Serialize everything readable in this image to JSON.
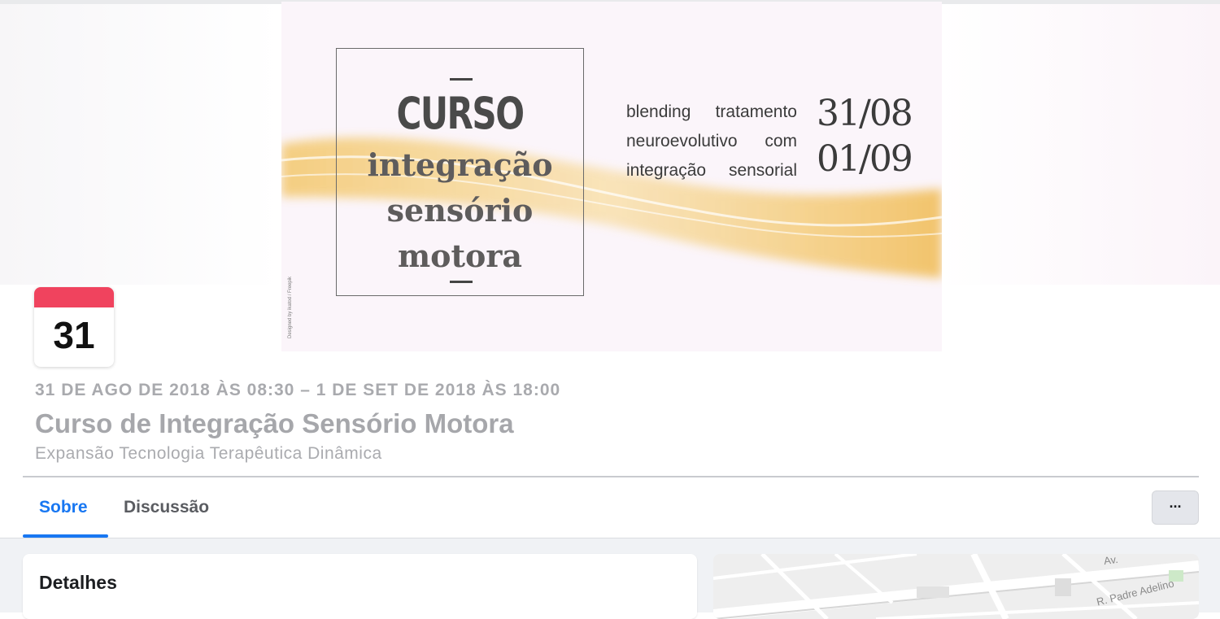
{
  "cover": {
    "curso": "CURSO",
    "line1": "integração",
    "line2": "sensório",
    "line3": "motora",
    "blend_lines": [
      "blending tratamento",
      "neuroevolutivo com",
      "integração sensorial"
    ],
    "date_start": "31/08",
    "date_end": "01/09",
    "credit": "Designed by ikatod / Freepik"
  },
  "calendar": {
    "day": "31"
  },
  "event": {
    "datetime": "31 DE AGO DE 2018 ÀS 08:30 – 1 DE SET DE 2018 ÀS 18:00",
    "title": "Curso de Integração Sensório Motora",
    "organizer": "Expansão Tecnologia Terapêutica Dinâmica"
  },
  "tabs": [
    {
      "label": "Sobre",
      "active": true
    },
    {
      "label": "Discussão",
      "active": false
    }
  ],
  "more_label": "···",
  "details": {
    "heading": "Detalhes"
  },
  "map": {
    "street_labels": [
      "R. Padre Adelino",
      "Av."
    ]
  },
  "colors": {
    "accent": "#1877f2",
    "calendar_red": "#f0435e",
    "muted_text": "#a9aaae"
  }
}
